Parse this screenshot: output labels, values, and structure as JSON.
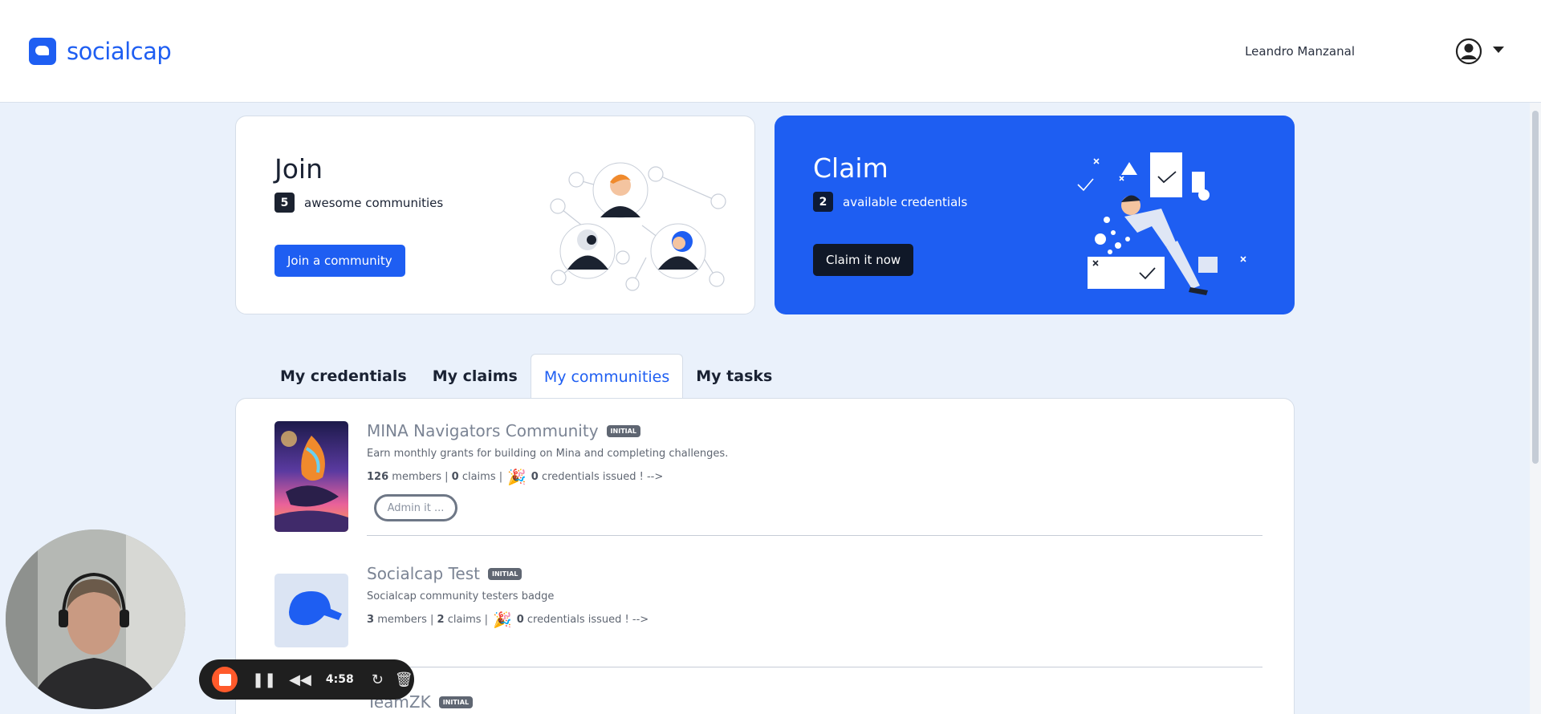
{
  "app": {
    "logo_text": "socialcap",
    "brand_color": "#1e5ef2"
  },
  "header": {
    "user_name": "Leandro Manzanal",
    "avatar_icon": "user-circle-icon",
    "menu_icon": "caret-down-icon"
  },
  "join_card": {
    "title": "Join",
    "count": "5",
    "count_label": "awesome communities",
    "button_label": "Join a community"
  },
  "claim_card": {
    "title": "Claim",
    "count": "2",
    "count_label": "available credentials",
    "button_label": "Claim it now"
  },
  "tabs": [
    {
      "label": "My credentials",
      "active": false
    },
    {
      "label": "My claims",
      "active": false
    },
    {
      "label": "My communities",
      "active": true
    },
    {
      "label": "My tasks",
      "active": false
    }
  ],
  "communities": [
    {
      "name": "MINA Navigators Community",
      "status": "INITIAL",
      "description": "Earn monthly grants for building on Mina and completing challenges.",
      "members": "126",
      "members_label": "members |",
      "claims": "0",
      "claims_label": "claims |",
      "credentials": "0",
      "credentials_label": "credentials issued ! -->",
      "admin_label": "Admin it ..."
    },
    {
      "name": "Socialcap Test",
      "status": "INITIAL",
      "description": "Socialcap community testers badge",
      "members": "3",
      "members_label": "members |",
      "claims": "2",
      "claims_label": "claims |",
      "credentials": "0",
      "credentials_label": "credentials issued ! -->"
    },
    {
      "name": "TeamZK",
      "status": "INITIAL"
    }
  ],
  "recorder": {
    "time": "4:58"
  }
}
